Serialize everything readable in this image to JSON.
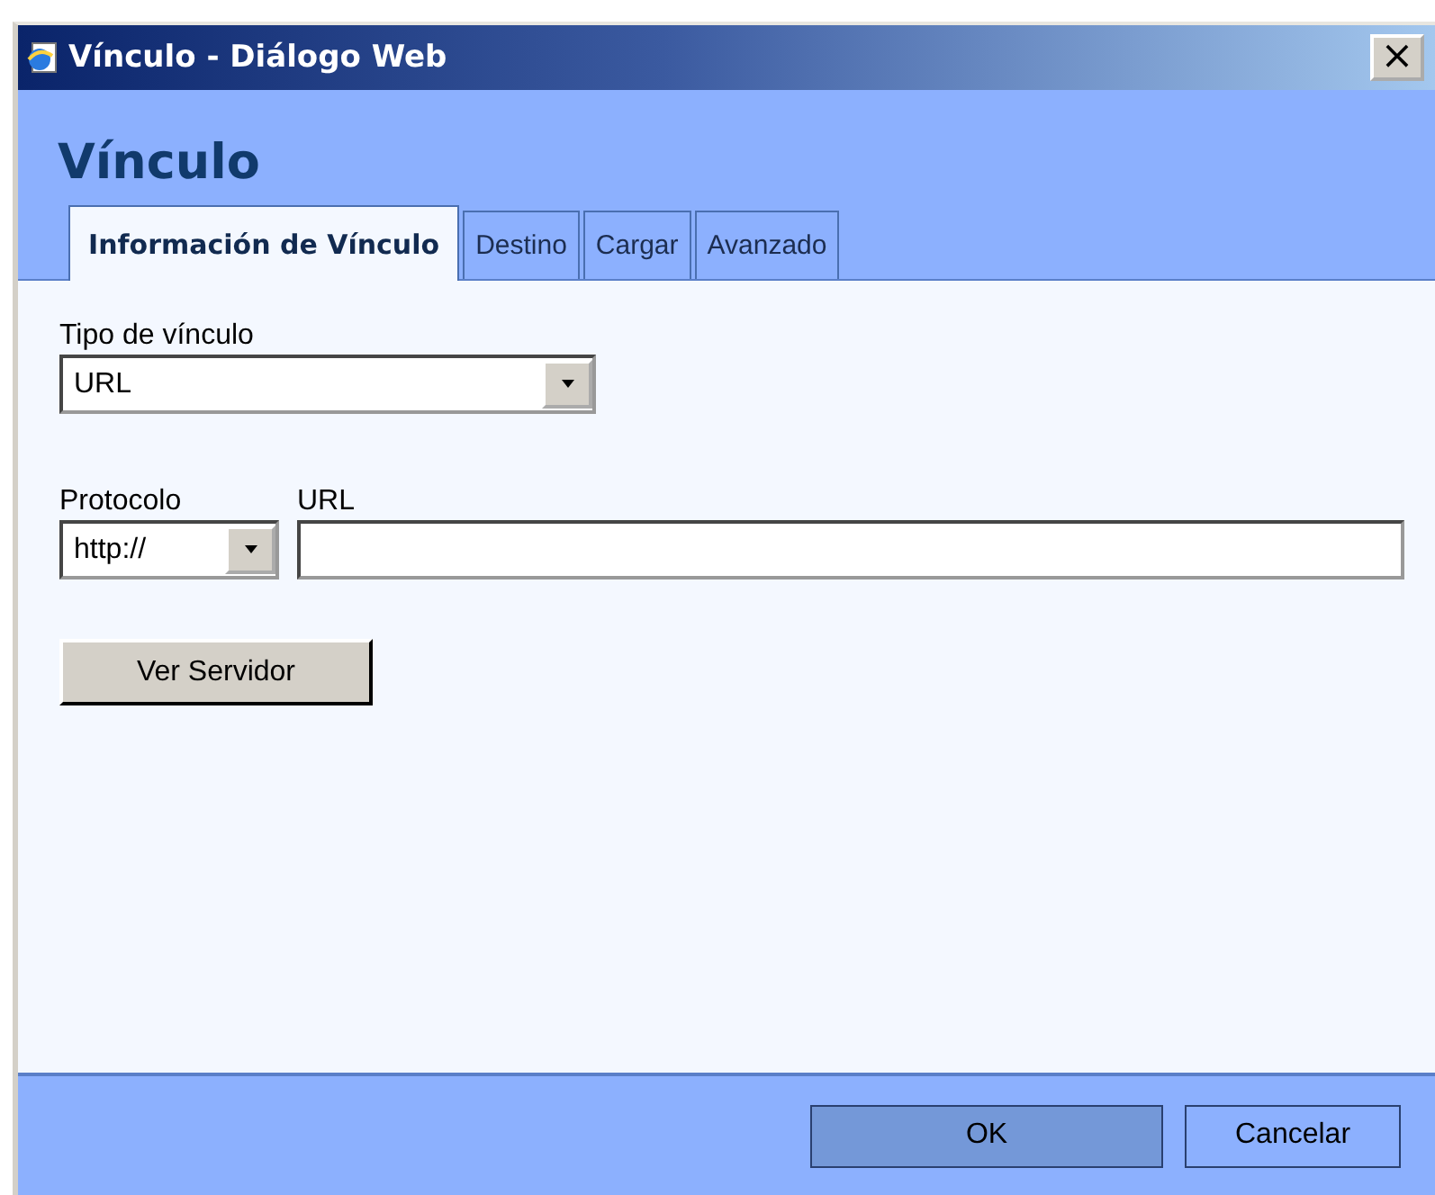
{
  "window": {
    "title": "Vínculo - Diálogo Web",
    "close": "×"
  },
  "header": {
    "title": "Vínculo"
  },
  "tabs": [
    {
      "label": "Información de Vínculo",
      "selected": true
    },
    {
      "label": "Destino",
      "selected": false
    },
    {
      "label": "Cargar",
      "selected": false
    },
    {
      "label": "Avanzado",
      "selected": false
    }
  ],
  "link_type": {
    "label": "Tipo de vínculo",
    "value": "URL"
  },
  "protocol": {
    "label": "Protocolo",
    "value": "http://"
  },
  "url": {
    "label": "URL"
  },
  "browse_button": "Ver Servidor",
  "buttons": [
    {
      "label": "OK",
      "default": true
    },
    {
      "label": "Cancelar",
      "default": false
    }
  ]
}
